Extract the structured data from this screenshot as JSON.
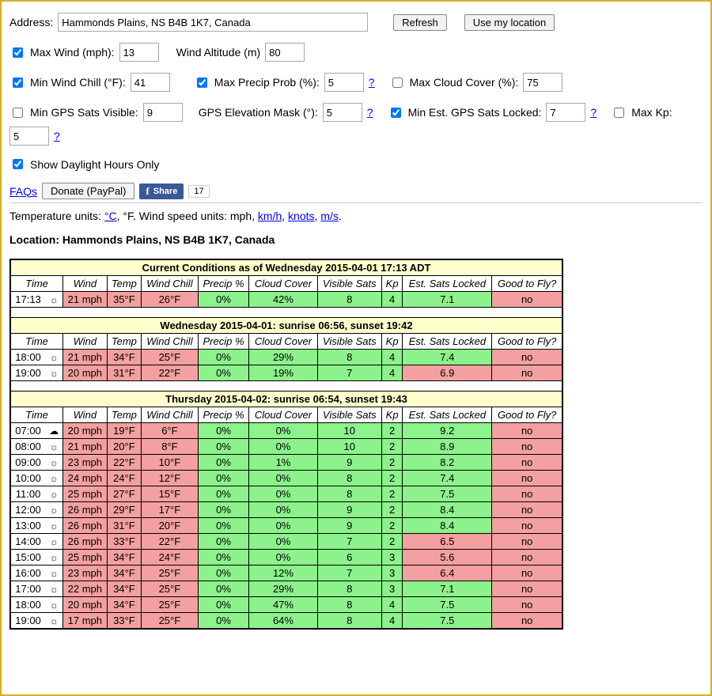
{
  "form": {
    "address_lbl": "Address:",
    "address_val": "Hammonds Plains, NS B4B 1K7, Canada",
    "refresh": "Refresh",
    "use_loc": "Use my location",
    "max_wind_lbl": "Max Wind (mph):",
    "max_wind_val": "13",
    "wind_alt_lbl": "Wind Altitude (m)",
    "wind_alt_val": "80",
    "min_chill_lbl": "Min Wind Chill (°F):",
    "min_chill_val": "41",
    "max_precip_lbl": "Max Precip Prob (%):",
    "max_precip_val": "5",
    "max_cloud_lbl": "Max Cloud Cover (%):",
    "max_cloud_val": "75",
    "min_sats_lbl": "Min GPS Sats Visible:",
    "min_sats_val": "9",
    "gps_mask_lbl": "GPS Elevation Mask (°):",
    "gps_mask_val": "5",
    "min_lock_lbl": "Min Est. GPS Sats Locked:",
    "min_lock_val": "7",
    "max_kp_lbl": "Max Kp:",
    "max_kp_val": "5",
    "daylight_lbl": "Show Daylight Hours Only",
    "faqs": "FAQs",
    "donate": "Donate (PayPal)",
    "fb_share": "Share",
    "fb_count": "17",
    "help": "?"
  },
  "checked": {
    "max_wind": true,
    "min_chill": true,
    "max_precip": true,
    "max_cloud": false,
    "min_sats": false,
    "min_lock": true,
    "max_kp": false,
    "daylight": true
  },
  "units": {
    "text1": "Temperature units: ",
    "c": "°C",
    "mid": ", °F. Wind speed units: mph, ",
    "kmh": "km/h",
    "sep1": ", ",
    "knots": "knots",
    "sep2": ", ",
    "ms": "m/s",
    "end": "."
  },
  "location": "Location: Hammonds Plains, NS B4B 1K7, Canada",
  "sections": [
    {
      "title": "Current Conditions as of Wednesday 2015-04-01 17:13 ADT",
      "rows": [
        {
          "time": "17:13",
          "icon": "partly",
          "wind": "21 mph",
          "temp": "35°F",
          "chill": "26°F",
          "precip": "0%",
          "cloud": "42%",
          "sats": "8",
          "kp": "4",
          "lock": "7.1",
          "good": "no",
          "c": {
            "wind": "bad",
            "temp": "bad",
            "chill": "bad",
            "precip": "good",
            "cloud": "good",
            "sats": "good",
            "kp": "good",
            "lock": "good",
            "good": "bad"
          }
        }
      ]
    },
    {
      "title": "Wednesday 2015-04-01: sunrise 06:56, sunset 19:42",
      "rows": [
        {
          "time": "18:00",
          "icon": "partly",
          "wind": "21 mph",
          "temp": "34°F",
          "chill": "25°F",
          "precip": "0%",
          "cloud": "29%",
          "sats": "8",
          "kp": "4",
          "lock": "7.4",
          "good": "no",
          "c": {
            "wind": "bad",
            "temp": "bad",
            "chill": "bad",
            "precip": "good",
            "cloud": "good",
            "sats": "good",
            "kp": "good",
            "lock": "good",
            "good": "bad"
          }
        },
        {
          "time": "19:00",
          "icon": "sun",
          "wind": "20 mph",
          "temp": "31°F",
          "chill": "22°F",
          "precip": "0%",
          "cloud": "19%",
          "sats": "7",
          "kp": "4",
          "lock": "6.9",
          "good": "no",
          "c": {
            "wind": "bad",
            "temp": "bad",
            "chill": "bad",
            "precip": "good",
            "cloud": "good",
            "sats": "good",
            "kp": "good",
            "lock": "bad",
            "good": "bad"
          }
        }
      ]
    },
    {
      "title": "Thursday 2015-04-02: sunrise 06:54, sunset 19:43",
      "rows": [
        {
          "time": "07:00",
          "icon": "cloud",
          "wind": "20 mph",
          "temp": "19°F",
          "chill": "6°F",
          "precip": "0%",
          "cloud": "0%",
          "sats": "10",
          "kp": "2",
          "lock": "9.2",
          "good": "no",
          "c": {
            "wind": "bad",
            "temp": "bad",
            "chill": "bad",
            "precip": "good",
            "cloud": "good",
            "sats": "good",
            "kp": "good",
            "lock": "good",
            "good": "bad"
          }
        },
        {
          "time": "08:00",
          "icon": "sun",
          "wind": "21 mph",
          "temp": "20°F",
          "chill": "8°F",
          "precip": "0%",
          "cloud": "0%",
          "sats": "10",
          "kp": "2",
          "lock": "8.9",
          "good": "no",
          "c": {
            "wind": "bad",
            "temp": "bad",
            "chill": "bad",
            "precip": "good",
            "cloud": "good",
            "sats": "good",
            "kp": "good",
            "lock": "good",
            "good": "bad"
          }
        },
        {
          "time": "09:00",
          "icon": "sun",
          "wind": "23 mph",
          "temp": "22°F",
          "chill": "10°F",
          "precip": "0%",
          "cloud": "1%",
          "sats": "9",
          "kp": "2",
          "lock": "8.2",
          "good": "no",
          "c": {
            "wind": "bad",
            "temp": "bad",
            "chill": "bad",
            "precip": "good",
            "cloud": "good",
            "sats": "good",
            "kp": "good",
            "lock": "good",
            "good": "bad"
          }
        },
        {
          "time": "10:00",
          "icon": "sun",
          "wind": "24 mph",
          "temp": "24°F",
          "chill": "12°F",
          "precip": "0%",
          "cloud": "0%",
          "sats": "8",
          "kp": "2",
          "lock": "7.4",
          "good": "no",
          "c": {
            "wind": "bad",
            "temp": "bad",
            "chill": "bad",
            "precip": "good",
            "cloud": "good",
            "sats": "good",
            "kp": "good",
            "lock": "good",
            "good": "bad"
          }
        },
        {
          "time": "11:00",
          "icon": "sun",
          "wind": "25 mph",
          "temp": "27°F",
          "chill": "15°F",
          "precip": "0%",
          "cloud": "0%",
          "sats": "8",
          "kp": "2",
          "lock": "7.5",
          "good": "no",
          "c": {
            "wind": "bad",
            "temp": "bad",
            "chill": "bad",
            "precip": "good",
            "cloud": "good",
            "sats": "good",
            "kp": "good",
            "lock": "good",
            "good": "bad"
          }
        },
        {
          "time": "12:00",
          "icon": "sun",
          "wind": "26 mph",
          "temp": "29°F",
          "chill": "17°F",
          "precip": "0%",
          "cloud": "0%",
          "sats": "9",
          "kp": "2",
          "lock": "8.4",
          "good": "no",
          "c": {
            "wind": "bad",
            "temp": "bad",
            "chill": "bad",
            "precip": "good",
            "cloud": "good",
            "sats": "good",
            "kp": "good",
            "lock": "good",
            "good": "bad"
          }
        },
        {
          "time": "13:00",
          "icon": "sun",
          "wind": "26 mph",
          "temp": "31°F",
          "chill": "20°F",
          "precip": "0%",
          "cloud": "0%",
          "sats": "9",
          "kp": "2",
          "lock": "8.4",
          "good": "no",
          "c": {
            "wind": "bad",
            "temp": "bad",
            "chill": "bad",
            "precip": "good",
            "cloud": "good",
            "sats": "good",
            "kp": "good",
            "lock": "good",
            "good": "bad"
          }
        },
        {
          "time": "14:00",
          "icon": "sun",
          "wind": "26 mph",
          "temp": "33°F",
          "chill": "22°F",
          "precip": "0%",
          "cloud": "0%",
          "sats": "7",
          "kp": "2",
          "lock": "6.5",
          "good": "no",
          "c": {
            "wind": "bad",
            "temp": "bad",
            "chill": "bad",
            "precip": "good",
            "cloud": "good",
            "sats": "good",
            "kp": "good",
            "lock": "bad",
            "good": "bad"
          }
        },
        {
          "time": "15:00",
          "icon": "sun",
          "wind": "25 mph",
          "temp": "34°F",
          "chill": "24°F",
          "precip": "0%",
          "cloud": "0%",
          "sats": "6",
          "kp": "3",
          "lock": "5.6",
          "good": "no",
          "c": {
            "wind": "bad",
            "temp": "bad",
            "chill": "bad",
            "precip": "good",
            "cloud": "good",
            "sats": "good",
            "kp": "good",
            "lock": "bad",
            "good": "bad"
          }
        },
        {
          "time": "16:00",
          "icon": "sun",
          "wind": "23 mph",
          "temp": "34°F",
          "chill": "25°F",
          "precip": "0%",
          "cloud": "12%",
          "sats": "7",
          "kp": "3",
          "lock": "6.4",
          "good": "no",
          "c": {
            "wind": "bad",
            "temp": "bad",
            "chill": "bad",
            "precip": "good",
            "cloud": "good",
            "sats": "good",
            "kp": "good",
            "lock": "bad",
            "good": "bad"
          }
        },
        {
          "time": "17:00",
          "icon": "partly",
          "wind": "22 mph",
          "temp": "34°F",
          "chill": "25°F",
          "precip": "0%",
          "cloud": "29%",
          "sats": "8",
          "kp": "3",
          "lock": "7.1",
          "good": "no",
          "c": {
            "wind": "bad",
            "temp": "bad",
            "chill": "bad",
            "precip": "good",
            "cloud": "good",
            "sats": "good",
            "kp": "good",
            "lock": "good",
            "good": "bad"
          }
        },
        {
          "time": "18:00",
          "icon": "partly",
          "wind": "20 mph",
          "temp": "34°F",
          "chill": "25°F",
          "precip": "0%",
          "cloud": "47%",
          "sats": "8",
          "kp": "4",
          "lock": "7.5",
          "good": "no",
          "c": {
            "wind": "bad",
            "temp": "bad",
            "chill": "bad",
            "precip": "good",
            "cloud": "good",
            "sats": "good",
            "kp": "good",
            "lock": "good",
            "good": "bad"
          }
        },
        {
          "time": "19:00",
          "icon": "partly",
          "wind": "17 mph",
          "temp": "33°F",
          "chill": "25°F",
          "precip": "0%",
          "cloud": "64%",
          "sats": "8",
          "kp": "4",
          "lock": "7.5",
          "good": "no",
          "c": {
            "wind": "bad",
            "temp": "bad",
            "chill": "bad",
            "precip": "good",
            "cloud": "good",
            "sats": "good",
            "kp": "good",
            "lock": "good",
            "good": "bad"
          }
        }
      ]
    }
  ],
  "cols": [
    "Time",
    "Wind",
    "Temp",
    "Wind Chill",
    "Precip %",
    "Cloud Cover",
    "Visible Sats",
    "Kp",
    "Est. Sats Locked",
    "Good to Fly?"
  ]
}
